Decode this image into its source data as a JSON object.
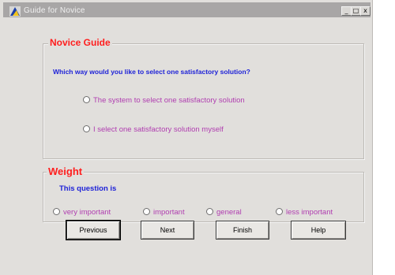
{
  "window": {
    "title": "Guide for Novice",
    "controls": {
      "minimize": "_",
      "maximize": "□",
      "close": "x"
    }
  },
  "novice_guide": {
    "legend": "Novice Guide",
    "question": "Which way would you like to select one satisfactory solution?",
    "options": [
      "The system to select one satisfactory solution",
      "I select one satisfactory solution myself"
    ]
  },
  "weight": {
    "legend": "Weight",
    "question": "This question is",
    "options": [
      "very important",
      "important",
      "general",
      "less important"
    ]
  },
  "buttons": {
    "previous": "Previous",
    "next": "Next",
    "finish": "Finish",
    "help": "Help"
  },
  "colors": {
    "legend": "#ff1e1e",
    "question": "#1e22d8",
    "option_text": "#b03db0",
    "title_bar": "#a8a6a6",
    "window_bg": "#e1dfdc"
  },
  "icons": {
    "app": "app-icon"
  }
}
